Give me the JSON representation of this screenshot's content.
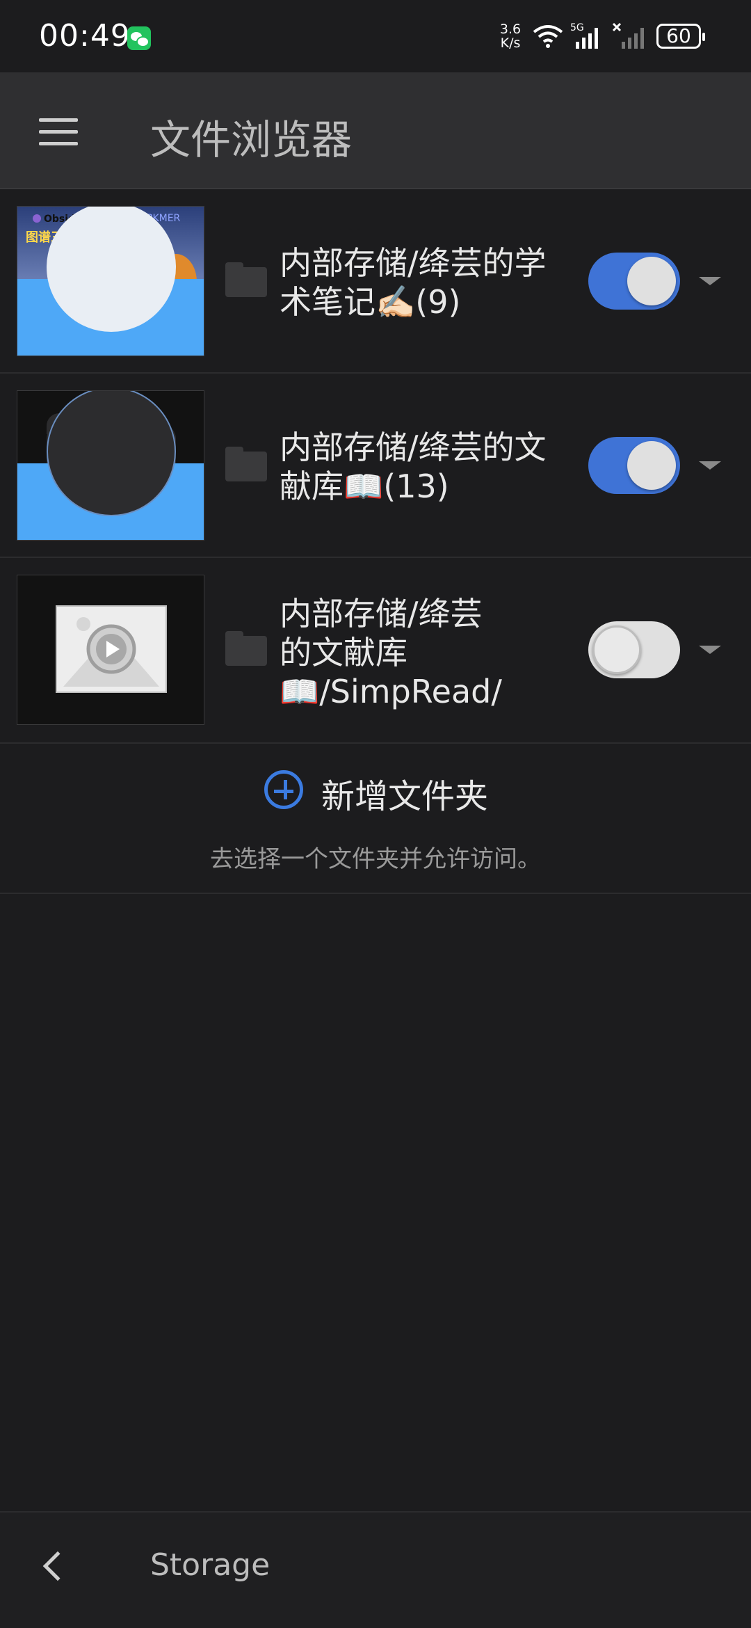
{
  "status_bar": {
    "time": "00:49",
    "net_speed_value": "3.6",
    "net_speed_unit": "K/s",
    "signal_label": "5G",
    "battery": "60"
  },
  "app_bar": {
    "title": "文件浏览器",
    "menu_icon": "hamburger-menu-icon"
  },
  "folders": [
    {
      "path_label": "内部存储/绛芸的学术笔记✍🏻(9)",
      "enabled": true,
      "thumbnail": {
        "brand": "Obsidian",
        "brand2": "PKMER",
        "caption": "图谱三维化，知识可视化"
      }
    },
    {
      "path_label": "内部存储/绛芸的文献库📖(13)",
      "enabled": true,
      "thumbnail": {}
    },
    {
      "path_label": "内部存储/绛芸的文献库📖/SimpRead/",
      "enabled": false,
      "thumbnail": {}
    }
  ],
  "add_folder": {
    "label": "新增文件夹",
    "hint": "去选择一个文件夹并允许访问。"
  },
  "bottom_bar": {
    "label": "Storage"
  },
  "colors": {
    "background": "#1c1c1e",
    "toggle_on": "#3f73d6",
    "accent": "#3b7be0",
    "tray": "#4ea8f7"
  }
}
